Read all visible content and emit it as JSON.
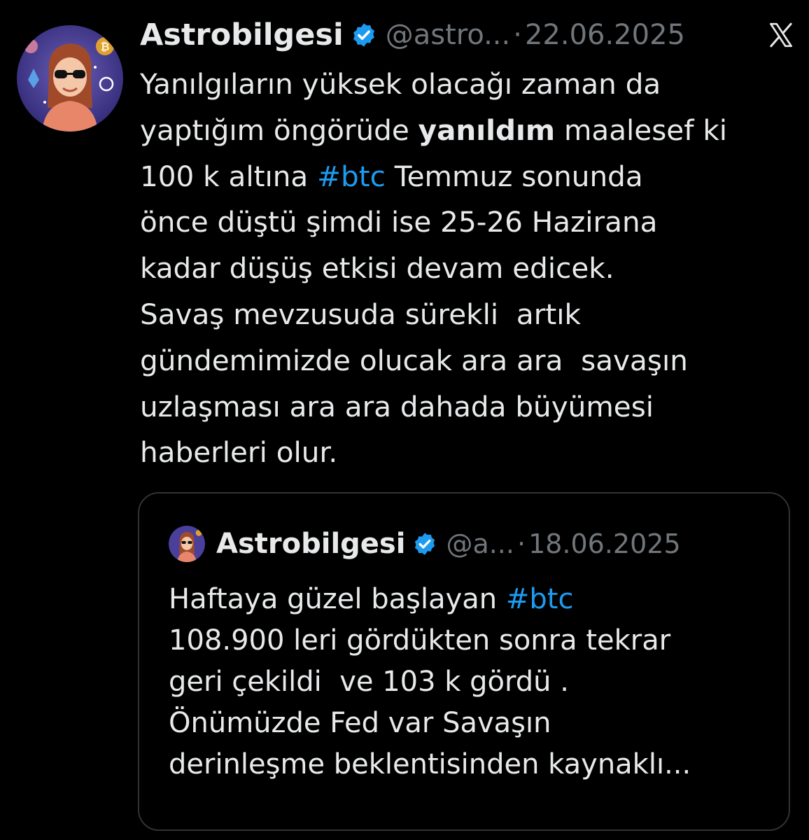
{
  "colors": {
    "background": "#000000",
    "text": "#e7e9ea",
    "muted": "#71767b",
    "hashtag": "#1d9bf0",
    "verified_badge": "#1d9bf0",
    "quote_border": "#2f3336"
  },
  "tweet": {
    "author_name": "Astrobilgesi",
    "handle": "@astro...",
    "separator": "·",
    "date": "22.06.2025",
    "avatar_icon": "avatar-illustration",
    "verified_icon": "verified-badge-icon",
    "platform_icon": "x-logo-icon",
    "lines": [
      {
        "a": "Yanılgıların yüksek olacağı zaman da"
      },
      {
        "a": "yaptığım öngörüde ",
        "bold": "yanıldım",
        "b": " maalesef ki"
      },
      {
        "a": "100 k altına ",
        "tag": "#btc",
        "b": " Temmuz sonunda"
      },
      {
        "a": "önce düştü şimdi ise 25-26 Hazirana"
      },
      {
        "a": "kadar düşüş etkisi devam edicek."
      },
      {
        "a": "Savaş mevzusuda sürekli  artık"
      },
      {
        "a": "gündemimizde olucak ara ara  savaşın"
      },
      {
        "a": "uzlaşması ara ara dahada büyümesi"
      },
      {
        "a": "haberleri olur."
      }
    ]
  },
  "quoted": {
    "author_name": "Astrobilgesi",
    "handle": "@a...",
    "separator": "·",
    "date": "18.06.2025",
    "lines": [
      {
        "a": "Haftaya güzel başlayan ",
        "tag": "#btc"
      },
      {
        "a": "108.900 leri gördükten sonra tekrar"
      },
      {
        "a": "geri çekildi  ve 103 k gördü ."
      },
      {
        "a": "Önümüzde Fed var Savaşın"
      },
      {
        "a": "derinleşme beklentisinden kaynaklı..."
      }
    ]
  }
}
